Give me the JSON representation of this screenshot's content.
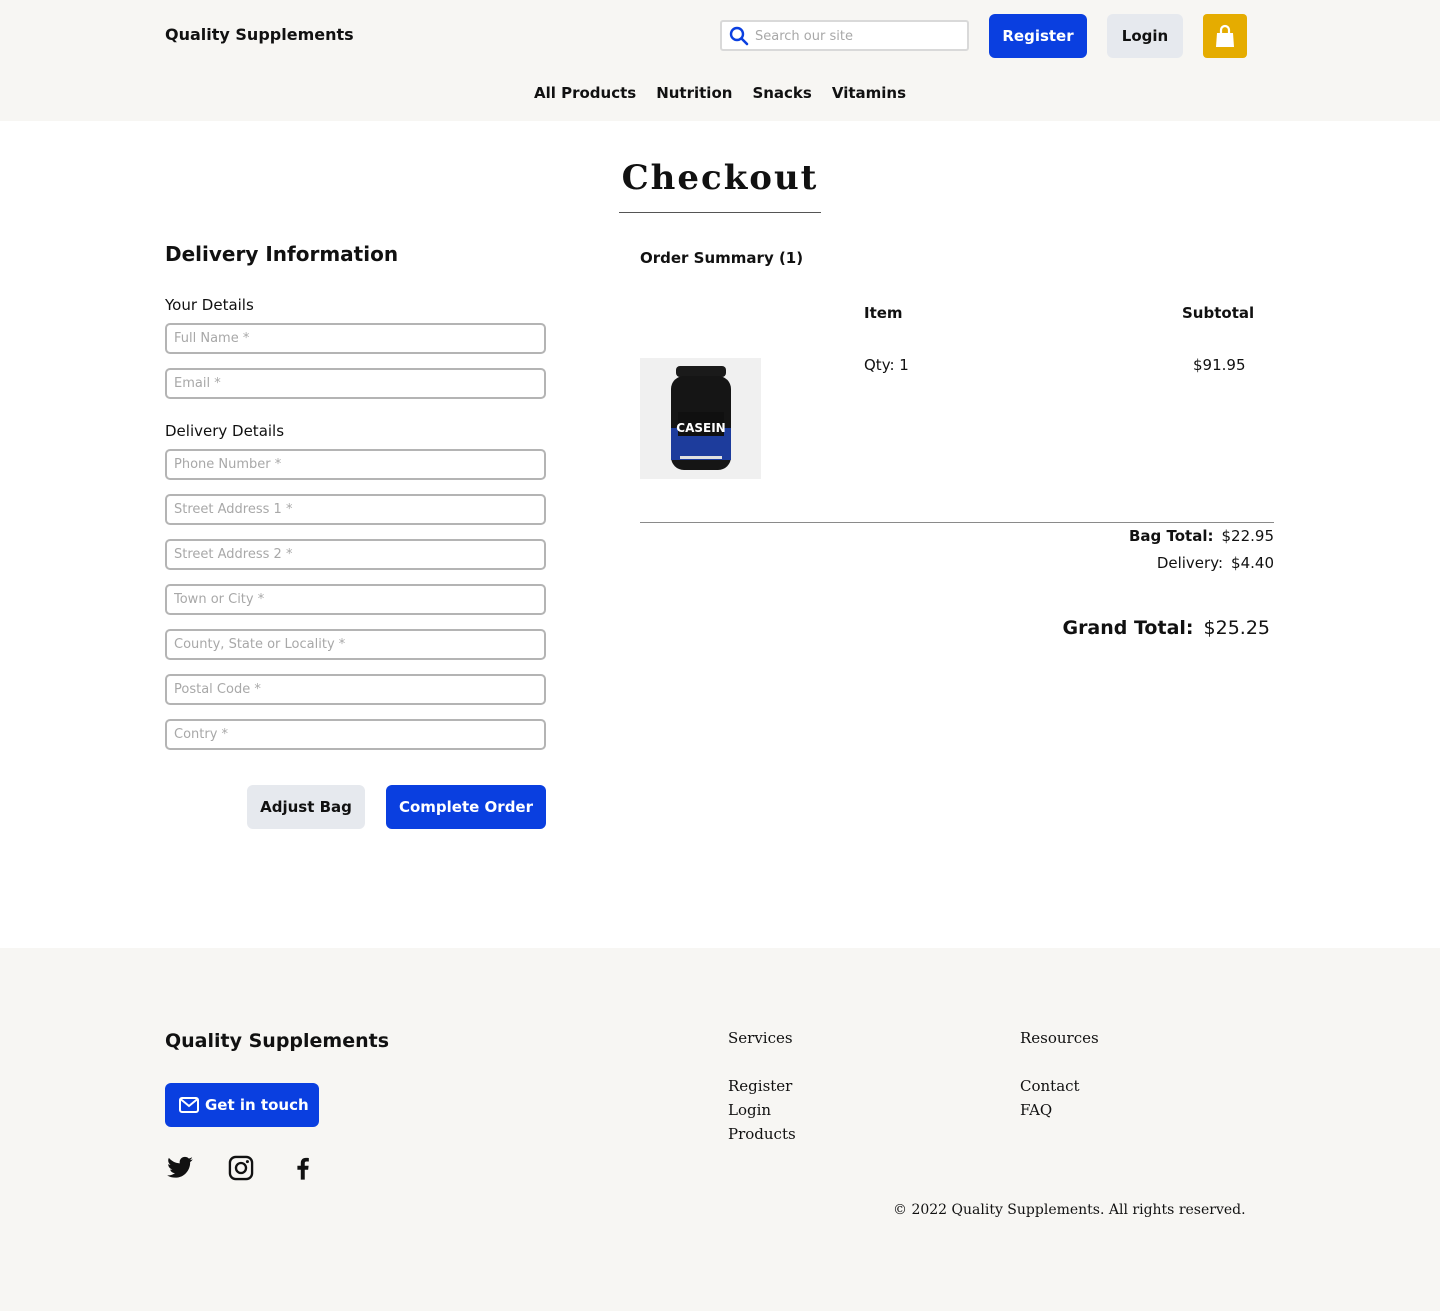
{
  "header": {
    "brand": "Quality Supplements",
    "search_placeholder": "Search our site",
    "register_label": "Register",
    "login_label": "Login",
    "bag_color": "#e5ac00",
    "accent_color": "#0a3fe0",
    "nav": [
      "All Products",
      "Nutrition",
      "Snacks",
      "Vitamins"
    ]
  },
  "page": {
    "title": "Checkout"
  },
  "form": {
    "title": "Delivery Information",
    "your_details_label": "Your Details",
    "delivery_details_label": "Delivery Details",
    "fields": {
      "full_name": "Full Name *",
      "email": "Email *",
      "phone": "Phone Number *",
      "street1": "Street Address 1 *",
      "street2": "Street Address 2 *",
      "town": "Town or City *",
      "county": "County, State or Locality *",
      "postal": "Postal Code *",
      "country": "Contry *"
    },
    "adjust_label": "Adjust Bag",
    "complete_label": "Complete Order"
  },
  "summary": {
    "title": "Order Summary (1)",
    "col_item": "Item",
    "col_subtotal": "Subtotal",
    "product_image_text": "CASEIN",
    "qty": "Qty: 1",
    "price": "$91.95",
    "bag_total_label": "Bag Total:",
    "bag_total": "$22.95",
    "delivery_label": "Delivery:",
    "delivery": "$4.40",
    "grand_label": "Grand Total:",
    "grand": "$25.25"
  },
  "footer": {
    "brand": "Quality Supplements",
    "touch_label": "Get in touch",
    "social_icons": [
      "twitter-icon",
      "instagram-icon",
      "facebook-icon"
    ],
    "services_title": "Services",
    "services": [
      "Register",
      "Login",
      "Products"
    ],
    "resources_title": "Resources",
    "resources": [
      "Contact",
      "FAQ"
    ],
    "copyright": "© 2022 Quality Supplements. All rights reserved."
  }
}
